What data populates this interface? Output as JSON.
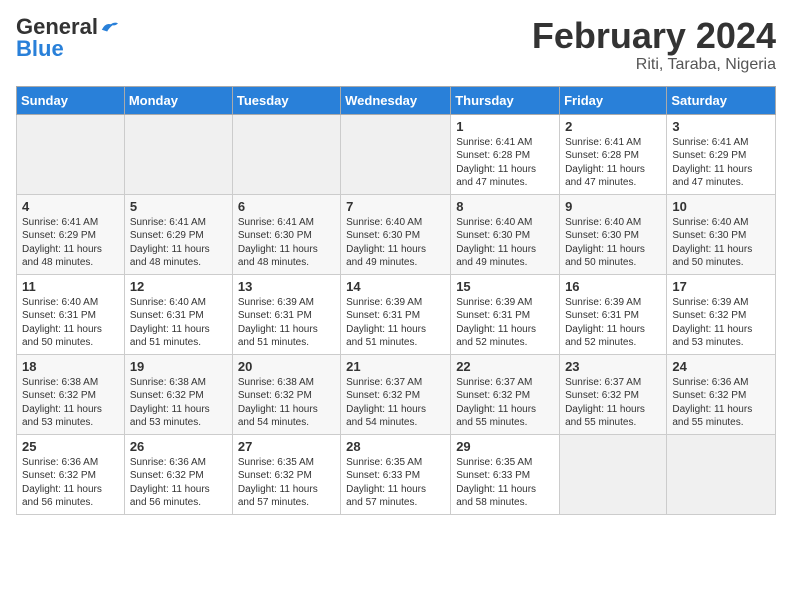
{
  "logo": {
    "top": "General",
    "bottom": "Blue"
  },
  "title": {
    "month_year": "February 2024",
    "location": "Riti, Taraba, Nigeria"
  },
  "header_days": [
    "Sunday",
    "Monday",
    "Tuesday",
    "Wednesday",
    "Thursday",
    "Friday",
    "Saturday"
  ],
  "weeks": [
    [
      {
        "day": "",
        "info": ""
      },
      {
        "day": "",
        "info": ""
      },
      {
        "day": "",
        "info": ""
      },
      {
        "day": "",
        "info": ""
      },
      {
        "day": "1",
        "info": "Sunrise: 6:41 AM\nSunset: 6:28 PM\nDaylight: 11 hours\nand 47 minutes."
      },
      {
        "day": "2",
        "info": "Sunrise: 6:41 AM\nSunset: 6:28 PM\nDaylight: 11 hours\nand 47 minutes."
      },
      {
        "day": "3",
        "info": "Sunrise: 6:41 AM\nSunset: 6:29 PM\nDaylight: 11 hours\nand 47 minutes."
      }
    ],
    [
      {
        "day": "4",
        "info": "Sunrise: 6:41 AM\nSunset: 6:29 PM\nDaylight: 11 hours\nand 48 minutes."
      },
      {
        "day": "5",
        "info": "Sunrise: 6:41 AM\nSunset: 6:29 PM\nDaylight: 11 hours\nand 48 minutes."
      },
      {
        "day": "6",
        "info": "Sunrise: 6:41 AM\nSunset: 6:30 PM\nDaylight: 11 hours\nand 48 minutes."
      },
      {
        "day": "7",
        "info": "Sunrise: 6:40 AM\nSunset: 6:30 PM\nDaylight: 11 hours\nand 49 minutes."
      },
      {
        "day": "8",
        "info": "Sunrise: 6:40 AM\nSunset: 6:30 PM\nDaylight: 11 hours\nand 49 minutes."
      },
      {
        "day": "9",
        "info": "Sunrise: 6:40 AM\nSunset: 6:30 PM\nDaylight: 11 hours\nand 50 minutes."
      },
      {
        "day": "10",
        "info": "Sunrise: 6:40 AM\nSunset: 6:30 PM\nDaylight: 11 hours\nand 50 minutes."
      }
    ],
    [
      {
        "day": "11",
        "info": "Sunrise: 6:40 AM\nSunset: 6:31 PM\nDaylight: 11 hours\nand 50 minutes."
      },
      {
        "day": "12",
        "info": "Sunrise: 6:40 AM\nSunset: 6:31 PM\nDaylight: 11 hours\nand 51 minutes."
      },
      {
        "day": "13",
        "info": "Sunrise: 6:39 AM\nSunset: 6:31 PM\nDaylight: 11 hours\nand 51 minutes."
      },
      {
        "day": "14",
        "info": "Sunrise: 6:39 AM\nSunset: 6:31 PM\nDaylight: 11 hours\nand 51 minutes."
      },
      {
        "day": "15",
        "info": "Sunrise: 6:39 AM\nSunset: 6:31 PM\nDaylight: 11 hours\nand 52 minutes."
      },
      {
        "day": "16",
        "info": "Sunrise: 6:39 AM\nSunset: 6:31 PM\nDaylight: 11 hours\nand 52 minutes."
      },
      {
        "day": "17",
        "info": "Sunrise: 6:39 AM\nSunset: 6:32 PM\nDaylight: 11 hours\nand 53 minutes."
      }
    ],
    [
      {
        "day": "18",
        "info": "Sunrise: 6:38 AM\nSunset: 6:32 PM\nDaylight: 11 hours\nand 53 minutes."
      },
      {
        "day": "19",
        "info": "Sunrise: 6:38 AM\nSunset: 6:32 PM\nDaylight: 11 hours\nand 53 minutes."
      },
      {
        "day": "20",
        "info": "Sunrise: 6:38 AM\nSunset: 6:32 PM\nDaylight: 11 hours\nand 54 minutes."
      },
      {
        "day": "21",
        "info": "Sunrise: 6:37 AM\nSunset: 6:32 PM\nDaylight: 11 hours\nand 54 minutes."
      },
      {
        "day": "22",
        "info": "Sunrise: 6:37 AM\nSunset: 6:32 PM\nDaylight: 11 hours\nand 55 minutes."
      },
      {
        "day": "23",
        "info": "Sunrise: 6:37 AM\nSunset: 6:32 PM\nDaylight: 11 hours\nand 55 minutes."
      },
      {
        "day": "24",
        "info": "Sunrise: 6:36 AM\nSunset: 6:32 PM\nDaylight: 11 hours\nand 55 minutes."
      }
    ],
    [
      {
        "day": "25",
        "info": "Sunrise: 6:36 AM\nSunset: 6:32 PM\nDaylight: 11 hours\nand 56 minutes."
      },
      {
        "day": "26",
        "info": "Sunrise: 6:36 AM\nSunset: 6:32 PM\nDaylight: 11 hours\nand 56 minutes."
      },
      {
        "day": "27",
        "info": "Sunrise: 6:35 AM\nSunset: 6:32 PM\nDaylight: 11 hours\nand 57 minutes."
      },
      {
        "day": "28",
        "info": "Sunrise: 6:35 AM\nSunset: 6:33 PM\nDaylight: 11 hours\nand 57 minutes."
      },
      {
        "day": "29",
        "info": "Sunrise: 6:35 AM\nSunset: 6:33 PM\nDaylight: 11 hours\nand 58 minutes."
      },
      {
        "day": "",
        "info": ""
      },
      {
        "day": "",
        "info": ""
      }
    ]
  ]
}
